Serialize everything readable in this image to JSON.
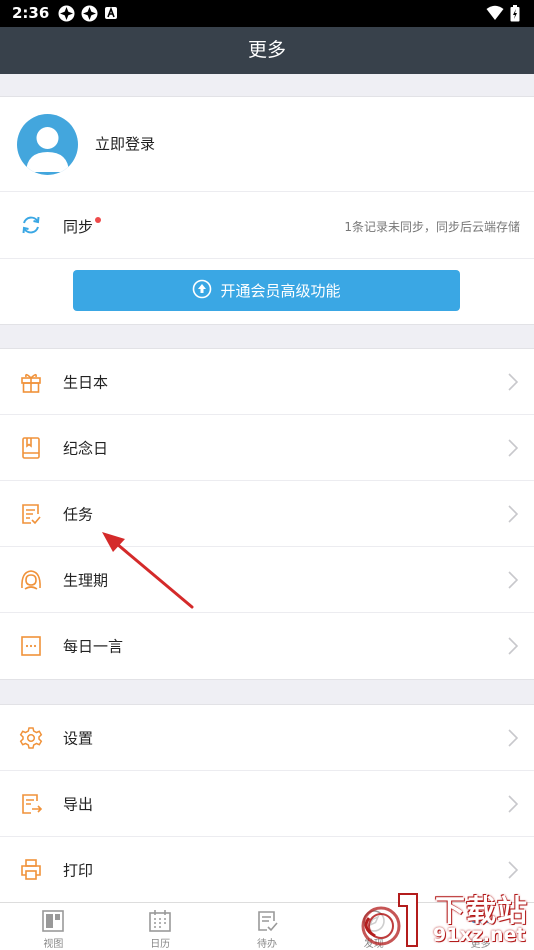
{
  "status_bar": {
    "time": "2:36"
  },
  "header": {
    "title": "更多"
  },
  "account": {
    "login_label": "立即登录"
  },
  "sync": {
    "label": "同步",
    "note": "1条记录未同步，同步后云端存储"
  },
  "vip": {
    "label": "开通会员高级功能"
  },
  "group1": [
    {
      "label": "生日本",
      "icon": "gift-icon"
    },
    {
      "label": "纪念日",
      "icon": "book-icon"
    },
    {
      "label": "任务",
      "icon": "task-icon"
    },
    {
      "label": "生理期",
      "icon": "woman-icon"
    },
    {
      "label": "每日一言",
      "icon": "message-icon"
    }
  ],
  "group2": [
    {
      "label": "设置",
      "icon": "gear-icon"
    },
    {
      "label": "导出",
      "icon": "export-icon"
    },
    {
      "label": "打印",
      "icon": "printer-icon"
    }
  ],
  "tabs": [
    {
      "label": "视图",
      "icon": "view-icon"
    },
    {
      "label": "日历",
      "icon": "calendar-icon"
    },
    {
      "label": "待办",
      "icon": "todo-icon"
    },
    {
      "label": "发现",
      "icon": "discover-icon"
    },
    {
      "label": "更多",
      "icon": "more-icon"
    }
  ],
  "watermark": {
    "line1": "下载站",
    "line2": "91xz.net"
  },
  "colors": {
    "accent": "#3aa7e4",
    "orange": "#f0923a",
    "header": "#38414b",
    "annotation": "#d42a2a"
  }
}
